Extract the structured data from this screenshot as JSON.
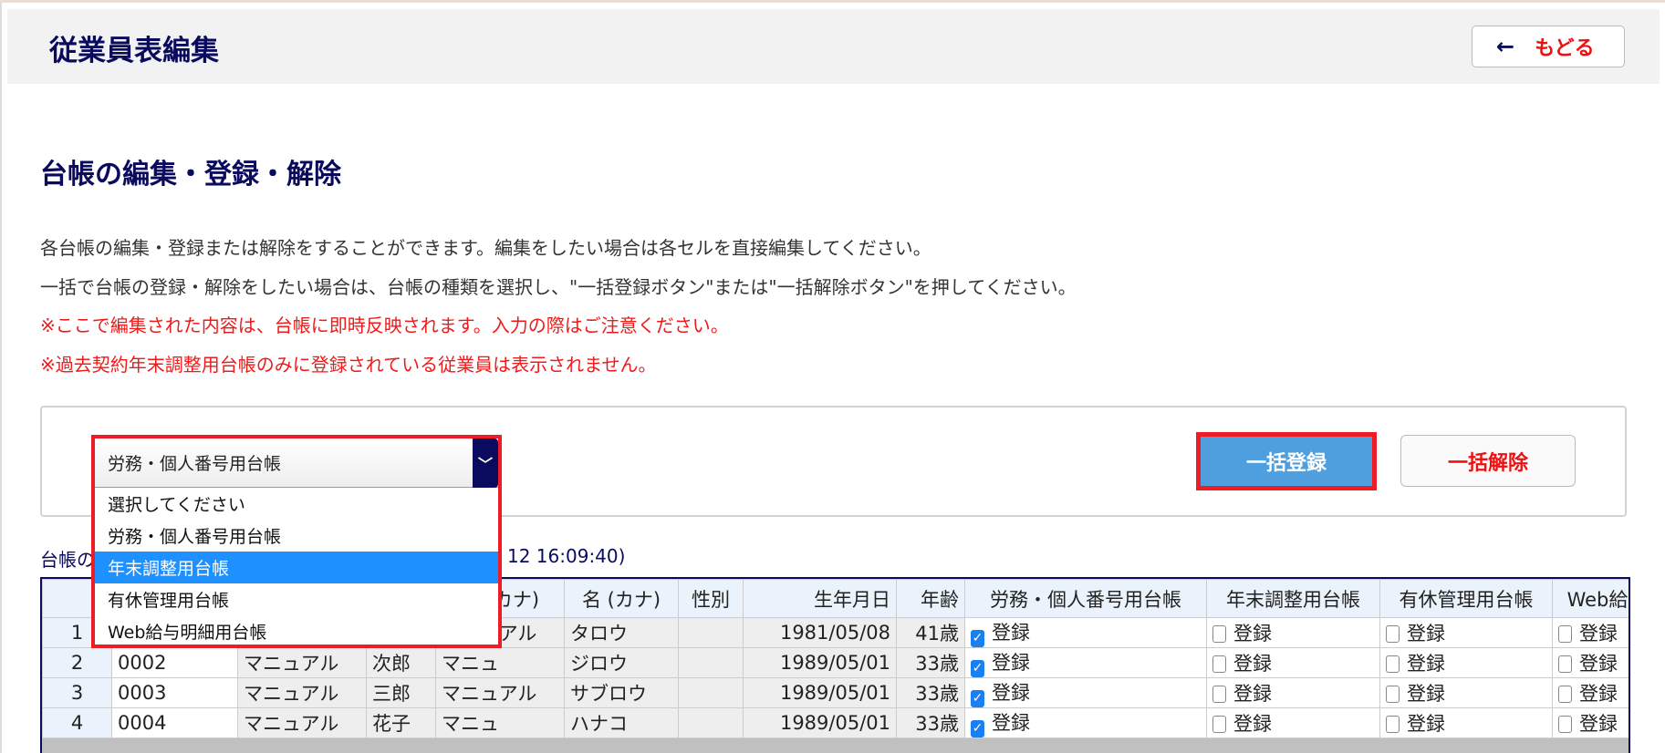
{
  "header": {
    "title": "従業員表編集",
    "back_label": "もどる"
  },
  "section": {
    "title": "台帳の編集・登録・解除",
    "lines": [
      "各台帳の編集・登録または解除をすることができます。編集をしたい場合は各セルを直接編集してください。",
      "一括で台帳の登録・解除をしたい場合は、台帳の種類を選択し、\"一括登録ボタン\"または\"一括解除ボタン\"を押してください。"
    ],
    "warnings": [
      "※ここで編集された内容は、台帳に即時反映されます。入力の際はご注意ください。",
      "※過去契約年末調整用台帳のみに登録されている従業員は表示されません。"
    ]
  },
  "ledger_select": {
    "value": "労務・個人番号用台帳",
    "options": [
      "選択してください",
      "労務・個人番号用台帳",
      "年末調整用台帳",
      "有休管理用台帳",
      "Web給与明細用台帳"
    ],
    "highlighted": "年末調整用台帳"
  },
  "buttons": {
    "bulk_register": "一括登録",
    "bulk_release": "一括解除"
  },
  "caption": {
    "visible_start": "台帳の",
    "visible_end": "12 16:09:40)"
  },
  "table": {
    "headers": [
      "",
      "",
      "",
      "",
      "姓 (カナ)",
      "名 (カナ)",
      "性別",
      "生年月日",
      "年齢",
      "労務・個人番号用台帳",
      "年末調整用台帳",
      "有休管理用台帳",
      "Web給与明細用台帳"
    ],
    "register_label": "登録",
    "rows": [
      {
        "no": "1",
        "code": "",
        "last": "",
        "first": "",
        "last_kana": "マニュアル",
        "first_kana": "タロウ",
        "gender": "",
        "birth": "1981/05/08",
        "age": "41歳",
        "checks": [
          true,
          false,
          false,
          false
        ]
      },
      {
        "no": "2",
        "code": "0002",
        "last": "マニュアル",
        "first": "次郎",
        "last_kana": "マニュ",
        "first_kana": "ジロウ",
        "gender": "",
        "birth": "1989/05/01",
        "age": "33歳",
        "checks": [
          true,
          false,
          false,
          false
        ]
      },
      {
        "no": "3",
        "code": "0003",
        "last": "マニュアル",
        "first": "三郎",
        "last_kana": "マニュアル",
        "first_kana": "サブロウ",
        "gender": "",
        "birth": "1989/05/01",
        "age": "33歳",
        "checks": [
          true,
          false,
          false,
          false
        ]
      },
      {
        "no": "4",
        "code": "0004",
        "last": "マニュアル",
        "first": "花子",
        "last_kana": "マニュ",
        "first_kana": "ハナコ",
        "gender": "",
        "birth": "1989/05/01",
        "age": "33歳",
        "checks": [
          true,
          false,
          false,
          false
        ]
      }
    ]
  }
}
